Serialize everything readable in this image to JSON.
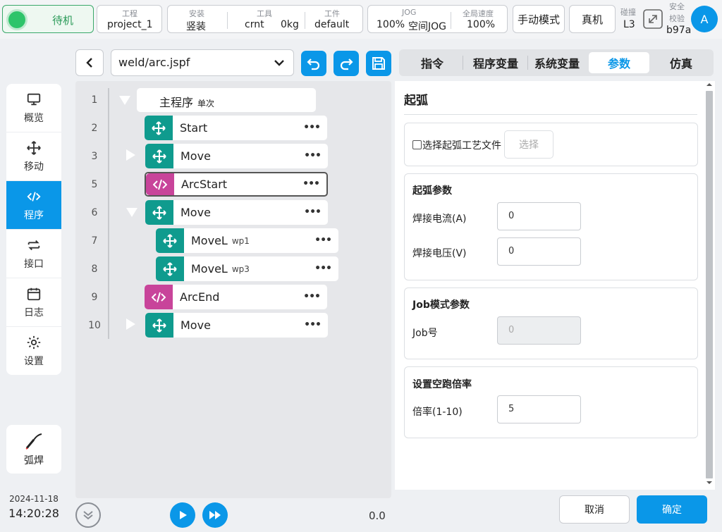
{
  "topbar": {
    "status": "待机",
    "project": {
      "caption": "工程",
      "value": "project_1"
    },
    "install": {
      "caption": "安装",
      "value": "竖装"
    },
    "tool": {
      "caption": "工具",
      "value": "crnt",
      "weight": "0kg"
    },
    "workpiece": {
      "caption": "工件",
      "value": "default"
    },
    "jog": {
      "caption": "JOG",
      "percent": "100%",
      "space": "空间JOG"
    },
    "global_speed": {
      "caption": "全局速度",
      "value": "100%"
    },
    "manual_mode": "手动模式",
    "real_machine": "真机",
    "collision": {
      "caption": "碰撞",
      "value": "L3"
    },
    "safety": {
      "caption1": "安全",
      "caption2": "校验",
      "value": "b97a"
    },
    "avatar": "A"
  },
  "nav": {
    "items": [
      {
        "label": "概览",
        "icon": "monitor-icon"
      },
      {
        "label": "移动",
        "icon": "move-icon"
      },
      {
        "label": "程序",
        "icon": "code-icon"
      },
      {
        "label": "接口",
        "icon": "swap-icon"
      },
      {
        "label": "日志",
        "icon": "calendar-icon"
      },
      {
        "label": "设置",
        "icon": "gear-icon"
      }
    ],
    "active": "程序",
    "weld": "弧焊",
    "date": "2024-11-18",
    "time": "14:20:28"
  },
  "program": {
    "file": "weld/arc.jspf",
    "main": {
      "label": "主程序",
      "sub": "单次"
    },
    "line_numbers": [
      "1",
      "2",
      "3",
      "5",
      "6",
      "7",
      "8",
      "9",
      "10"
    ],
    "nodes": [
      {
        "label": "Start",
        "sub": ""
      },
      {
        "label": "Move",
        "sub": ""
      },
      {
        "label": "ArcStart",
        "sub": ""
      },
      {
        "label": "Move",
        "sub": ""
      },
      {
        "label": "MoveL",
        "sub": "wp1"
      },
      {
        "label": "MoveL",
        "sub": "wp3"
      },
      {
        "label": "ArcEnd",
        "sub": ""
      },
      {
        "label": "Move",
        "sub": ""
      }
    ],
    "more": "•••",
    "run_value": "0.0"
  },
  "tabs": [
    "指令",
    "程序变量",
    "系统变量",
    "参数",
    "仿真"
  ],
  "active_tab": "参数",
  "panel": {
    "title": "起弧",
    "file_checkbox": "选择起弧工艺文件",
    "choose_button": "选择",
    "arc_params": {
      "title": "起弧参数",
      "current_label": "焊接电流(A)",
      "current_value": "0",
      "voltage_label": "焊接电压(V)",
      "voltage_value": "0"
    },
    "job_params": {
      "title": "Job模式参数",
      "job_label": "Job号",
      "job_value": "0"
    },
    "dry_run": {
      "title": "设置空跑倍率",
      "rate_label": "倍率(1-10)",
      "rate_value": "5"
    },
    "cancel": "取消",
    "confirm": "确定"
  },
  "colors": {
    "accent": "#0a97e8",
    "teal": "#0f9b8e",
    "pink": "#c8449a",
    "status_green": "#2ec46a"
  }
}
